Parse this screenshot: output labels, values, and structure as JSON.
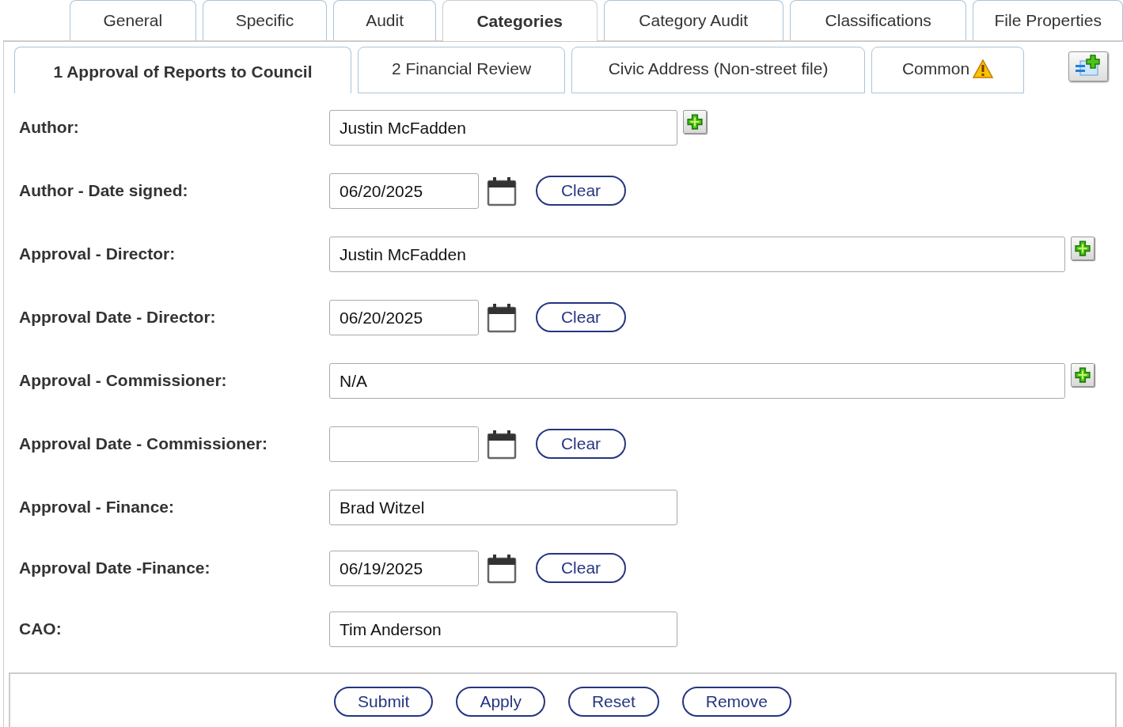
{
  "tabs": [
    {
      "label": "General",
      "selected": false
    },
    {
      "label": "Specific",
      "selected": false
    },
    {
      "label": "Audit",
      "selected": false
    },
    {
      "label": "Categories",
      "selected": true
    },
    {
      "label": "Category Audit",
      "selected": false
    },
    {
      "label": "Classifications",
      "selected": false
    },
    {
      "label": "File Properties",
      "selected": false
    }
  ],
  "subtabs": [
    {
      "label": "1 Approval of Reports to Council",
      "selected": true,
      "warning": false
    },
    {
      "label": "2 Financial Review",
      "selected": false,
      "warning": false
    },
    {
      "label": "Civic Address (Non-street file)",
      "selected": false,
      "warning": false
    },
    {
      "label": "Common",
      "selected": false,
      "warning": true
    }
  ],
  "fields": [
    {
      "label": "Author:",
      "kind": "text",
      "value": "Justin McFadden",
      "add_button": true
    },
    {
      "label": "Author - Date signed:",
      "kind": "date",
      "value": "06/20/2025",
      "clear": "Clear"
    },
    {
      "label": "Approval - Director:",
      "kind": "long-text",
      "value": "Justin McFadden",
      "add_button": true
    },
    {
      "label": "Approval Date - Director:",
      "kind": "date",
      "value": "06/20/2025",
      "clear": "Clear"
    },
    {
      "label": "Approval - Commissioner:",
      "kind": "long-text",
      "value": "N/A",
      "add_button": true
    },
    {
      "label": "Approval Date - Commissioner:",
      "kind": "date",
      "clear": "Clear"
    },
    {
      "label": "Approval - Finance:",
      "kind": "text",
      "value": "Brad Witzel",
      "add_button": false
    },
    {
      "label": "Approval Date -Finance:",
      "kind": "date",
      "value": "06/19/2025",
      "clear": "Clear"
    },
    {
      "label": "CAO:",
      "kind": "text",
      "value": "Tim Anderson",
      "add_button": false
    }
  ],
  "buttons": [
    "Submit",
    "Apply",
    "Reset",
    "Remove"
  ]
}
